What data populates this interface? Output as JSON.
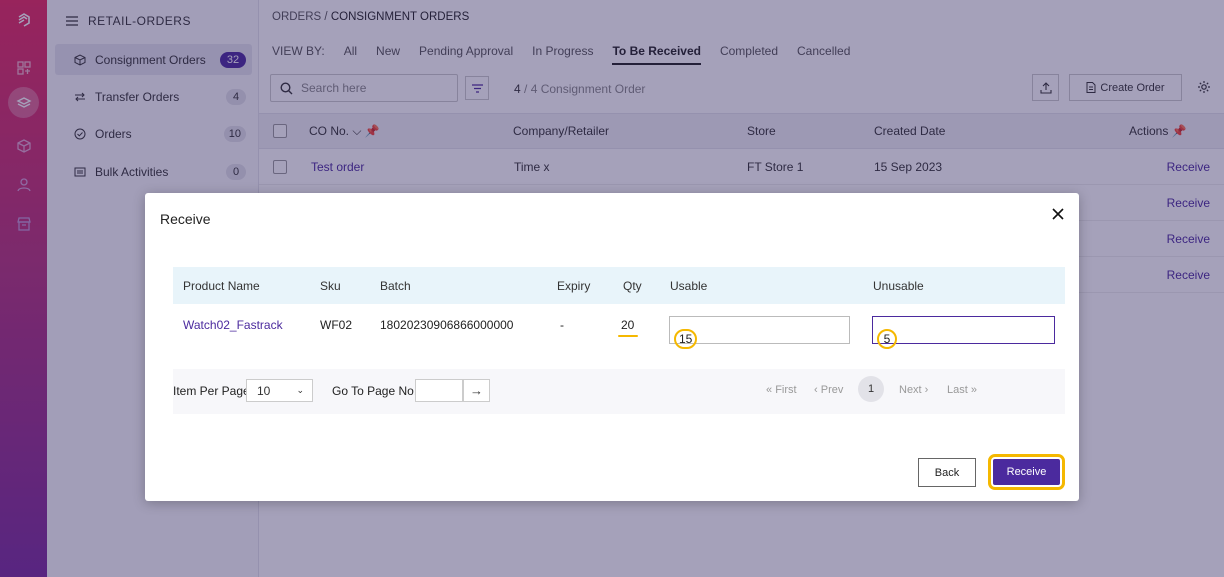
{
  "sidebar": {
    "header": "RETAIL-ORDERS",
    "items": [
      {
        "label": "Consignment Orders",
        "count": "32"
      },
      {
        "label": "Transfer Orders",
        "count": "4"
      },
      {
        "label": "Orders",
        "count": "10"
      },
      {
        "label": "Bulk Activities",
        "count": "0"
      }
    ]
  },
  "breadcrumb": {
    "root": "ORDERS",
    "sep": "/",
    "current": "CONSIGNMENT ORDERS"
  },
  "viewby": {
    "label": "VIEW BY:",
    "tabs": [
      "All",
      "New",
      "Pending Approval",
      "In Progress",
      "To Be Received",
      "Completed",
      "Cancelled"
    ],
    "active": "To Be Received"
  },
  "toolbar": {
    "search_placeholder": "Search here",
    "count_current": "4",
    "count_rest": "/ 4 Consignment Order",
    "create_label": "Create Order"
  },
  "table": {
    "headers": {
      "co_no": "CO No.",
      "company": "Company/Retailer",
      "store": "Store",
      "created": "Created Date",
      "actions": "Actions"
    },
    "rows": [
      {
        "co_no": "Test order",
        "company": "Time x",
        "store": "FT Store 1",
        "created": "15 Sep 2023",
        "action": "Receive"
      },
      {
        "action": "Receive"
      },
      {
        "action": "Receive"
      },
      {
        "action": "Receive"
      }
    ]
  },
  "modal": {
    "title": "Receive",
    "headers": {
      "product": "Product Name",
      "sku": "Sku",
      "batch": "Batch",
      "expiry": "Expiry",
      "qty": "Qty",
      "usable": "Usable",
      "unusable": "Unusable"
    },
    "row": {
      "product": "Watch02_Fastrack",
      "sku": "WF02",
      "batch": "18020230906866000000",
      "expiry": "-",
      "qty": "20",
      "usable": "15",
      "unusable": "5"
    },
    "pager": {
      "per_page_label": "Item Per Page",
      "per_page_value": "10",
      "goto_label": "Go To Page No.",
      "first": "First",
      "prev": "Prev",
      "page": "1",
      "next": "Next",
      "last": "Last"
    },
    "back_label": "Back",
    "receive_label": "Receive"
  },
  "colors": {
    "brand": "#4b2a9e",
    "highlight": "#f5b800",
    "rail_top": "#e8285e",
    "rail_bottom": "#7a2a9c"
  }
}
